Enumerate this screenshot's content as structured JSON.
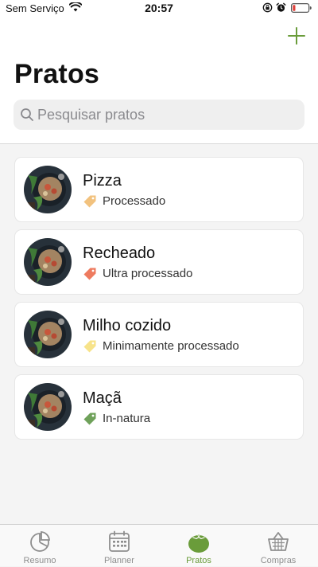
{
  "status_bar": {
    "carrier": "Sem Serviço",
    "time": "20:57"
  },
  "header": {
    "title": "Pratos",
    "add_icon": "plus-icon"
  },
  "search": {
    "placeholder": "Pesquisar pratos",
    "value": ""
  },
  "dishes": [
    {
      "name": "Pizza",
      "category": "Processado",
      "tag_color": "#f2c27e"
    },
    {
      "name": "Recheado",
      "category": "Ultra processado",
      "tag_color": "#ee7b5f"
    },
    {
      "name": "Milho cozido",
      "category": "Minimamente processado",
      "tag_color": "#f7e38a"
    },
    {
      "name": "Maçã",
      "category": "In-natura",
      "tag_color": "#6fa15a"
    }
  ],
  "tab_bar": {
    "items": [
      {
        "label": "Resumo",
        "icon": "pie-chart-icon",
        "active": false
      },
      {
        "label": "Planner",
        "icon": "calendar-icon",
        "active": false
      },
      {
        "label": "Pratos",
        "icon": "tomato-icon",
        "active": true
      },
      {
        "label": "Compras",
        "icon": "basket-icon",
        "active": false
      }
    ]
  },
  "colors": {
    "accent": "#6a9c3a",
    "battery_low": "#e0413c"
  }
}
